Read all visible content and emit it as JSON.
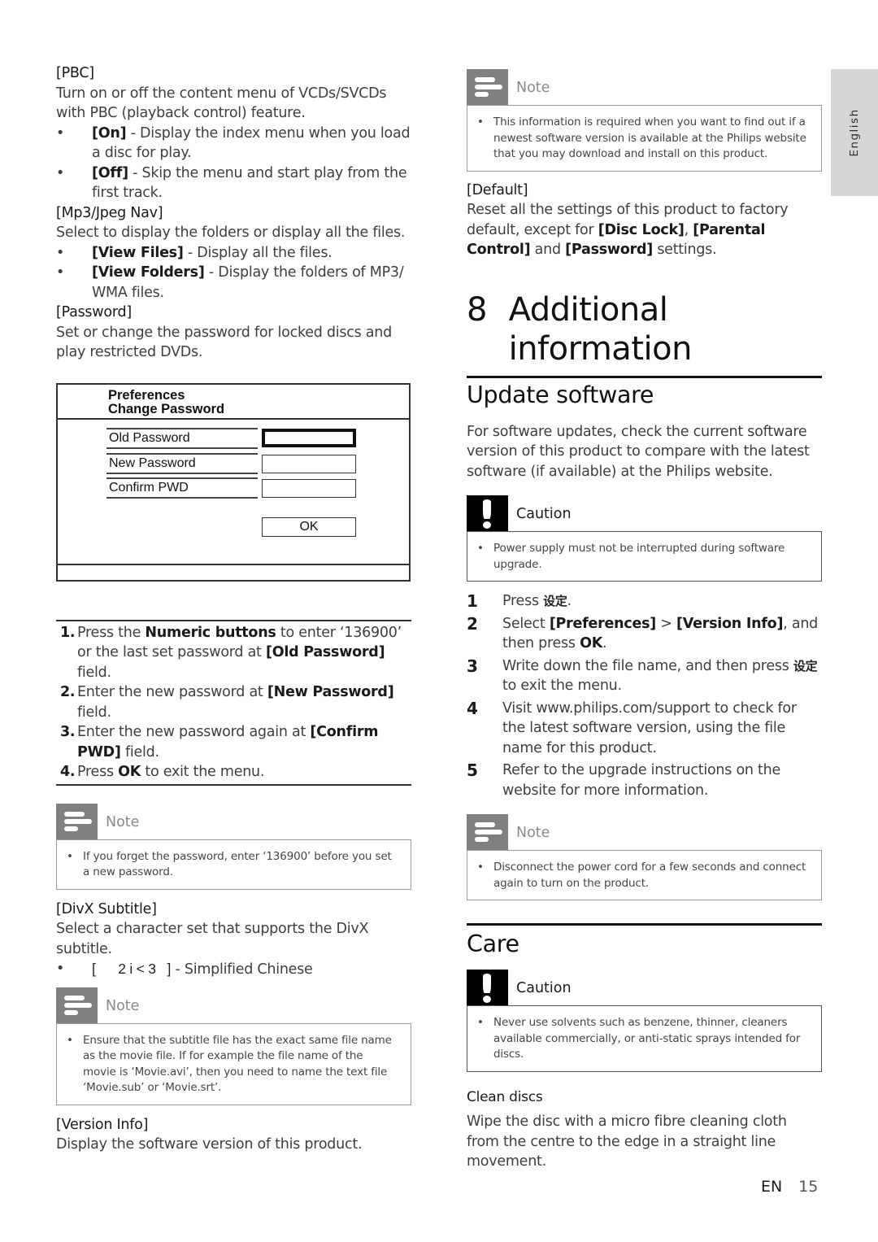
{
  "side_tab": {
    "label": "English"
  },
  "left": {
    "pbc": {
      "title": "[PBC]",
      "desc": "Turn on or off the content menu of VCDs/SVCDs with PBC (playback control) feature.",
      "options": [
        {
          "label": "[On]",
          "text": " - Display the index menu when you load a disc for play."
        },
        {
          "label": "[Off]",
          "text": " - Skip the menu and start play from the first track."
        }
      ]
    },
    "mp3nav": {
      "title": "[Mp3/Jpeg Nav]",
      "desc": "Select to display the folders or display all the files.",
      "options": [
        {
          "label": "[View Files]",
          "text": " - Display all the files."
        },
        {
          "label": "[View Folders]",
          "text": " - Display the folders of MP3/ WMA files."
        }
      ]
    },
    "password": {
      "title": "[Password]",
      "desc": "Set or change the password for locked discs and play restricted DVDs."
    },
    "menu": {
      "title_line1": "Preferences",
      "title_line2": "Change Password",
      "rows": [
        "Old Password",
        "New Password",
        "Confirm PWD"
      ],
      "ok": "OK"
    },
    "steps": [
      {
        "n": "1.",
        "parts": [
          [
            "Press the ",
            false
          ],
          [
            "Numeric buttons",
            true
          ],
          [
            " to enter ‘136900’ or the last set password at ",
            false
          ],
          [
            "[Old Password]",
            true
          ],
          [
            " field.",
            false
          ]
        ]
      },
      {
        "n": "2.",
        "parts": [
          [
            "Enter the new password at ",
            false
          ],
          [
            "[New Password]",
            true
          ],
          [
            " field.",
            false
          ]
        ]
      },
      {
        "n": "3.",
        "parts": [
          [
            "Enter the new password again at ",
            false
          ],
          [
            "[Confirm PWD]",
            true
          ],
          [
            " field.",
            false
          ]
        ]
      },
      {
        "n": "4.",
        "parts": [
          [
            "Press ",
            false
          ],
          [
            "OK",
            true
          ],
          [
            " to exit the menu.",
            false
          ]
        ]
      }
    ],
    "note1": {
      "title": "Note",
      "text": "If you forget the password, enter ‘136900’ before you set a new password."
    },
    "divx": {
      "title": "[DivX Subtitle]",
      "desc": "Select a character set that supports the DivX subtitle.",
      "option_label": "[      2 i < 3   ]",
      "option_text": " - Simplified Chinese"
    },
    "note2": {
      "title": "Note",
      "text": "Ensure that the subtitle file has the exact same file name as the movie file. If for example the file name of the movie is ‘Movie.avi’, then you need to name the text file ‘Movie.sub’ or ‘Movie.srt’."
    },
    "version": {
      "title": "[Version Info]",
      "desc": "Display the software version of this product."
    }
  },
  "right": {
    "note_top": {
      "title": "Note",
      "text": "This information is required when you want to find out if a newest software version is available at the Philips website that you may download and install on this product."
    },
    "default": {
      "title": "[Default]",
      "parts": [
        [
          "Reset all the settings of this product to factory default, except for ",
          false
        ],
        [
          "[Disc Lock]",
          true
        ],
        [
          ", ",
          false
        ],
        [
          "[Parental Control]",
          true
        ],
        [
          " and ",
          false
        ],
        [
          "[Password]",
          true
        ],
        [
          " settings.",
          false
        ]
      ]
    },
    "chapter": {
      "num": "8",
      "title": "Additional information"
    },
    "update": {
      "title": "Update software",
      "desc": "For software updates, check the current software version of this product to compare with the latest software (if available) at the Philips website.",
      "caution": {
        "title": "Caution",
        "text": "Power supply must not be interrupted during software upgrade."
      },
      "steps": [
        {
          "n": "1",
          "parts": [
            [
              "Press ",
              false
            ],
            [
              "设定",
              "cjk"
            ],
            [
              ".",
              false
            ]
          ]
        },
        {
          "n": "2",
          "parts": [
            [
              "Select ",
              false
            ],
            [
              "[Preferences]",
              true
            ],
            [
              " > ",
              false
            ],
            [
              "[Version Info]",
              true
            ],
            [
              ", and then press ",
              false
            ],
            [
              "OK",
              true
            ],
            [
              ".",
              false
            ]
          ]
        },
        {
          "n": "3",
          "parts": [
            [
              "Write down the file name, and then press ",
              false
            ],
            [
              "设定",
              "cjk"
            ],
            [
              " to exit the menu.",
              false
            ]
          ]
        },
        {
          "n": "4",
          "parts": [
            [
              "Visit www.philips.com/support to check for the latest software version, using the file name for this product.",
              false
            ]
          ]
        },
        {
          "n": "5",
          "parts": [
            [
              "Refer to the upgrade instructions on the website for more information.",
              false
            ]
          ]
        }
      ],
      "note": {
        "title": "Note",
        "text": "Disconnect the power cord for a few seconds and connect again to turn on the product."
      }
    },
    "care": {
      "title": "Care",
      "caution": {
        "title": "Caution",
        "text": "Never use solvents such as benzene, thinner, cleaners available commercially, or anti-static sprays intended for discs."
      },
      "clean_title": "Clean discs",
      "clean_desc": "Wipe the disc with a micro fibre cleaning cloth from the centre to the edge in a straight line movement."
    }
  },
  "footer": {
    "lang": "EN",
    "page": "15"
  }
}
